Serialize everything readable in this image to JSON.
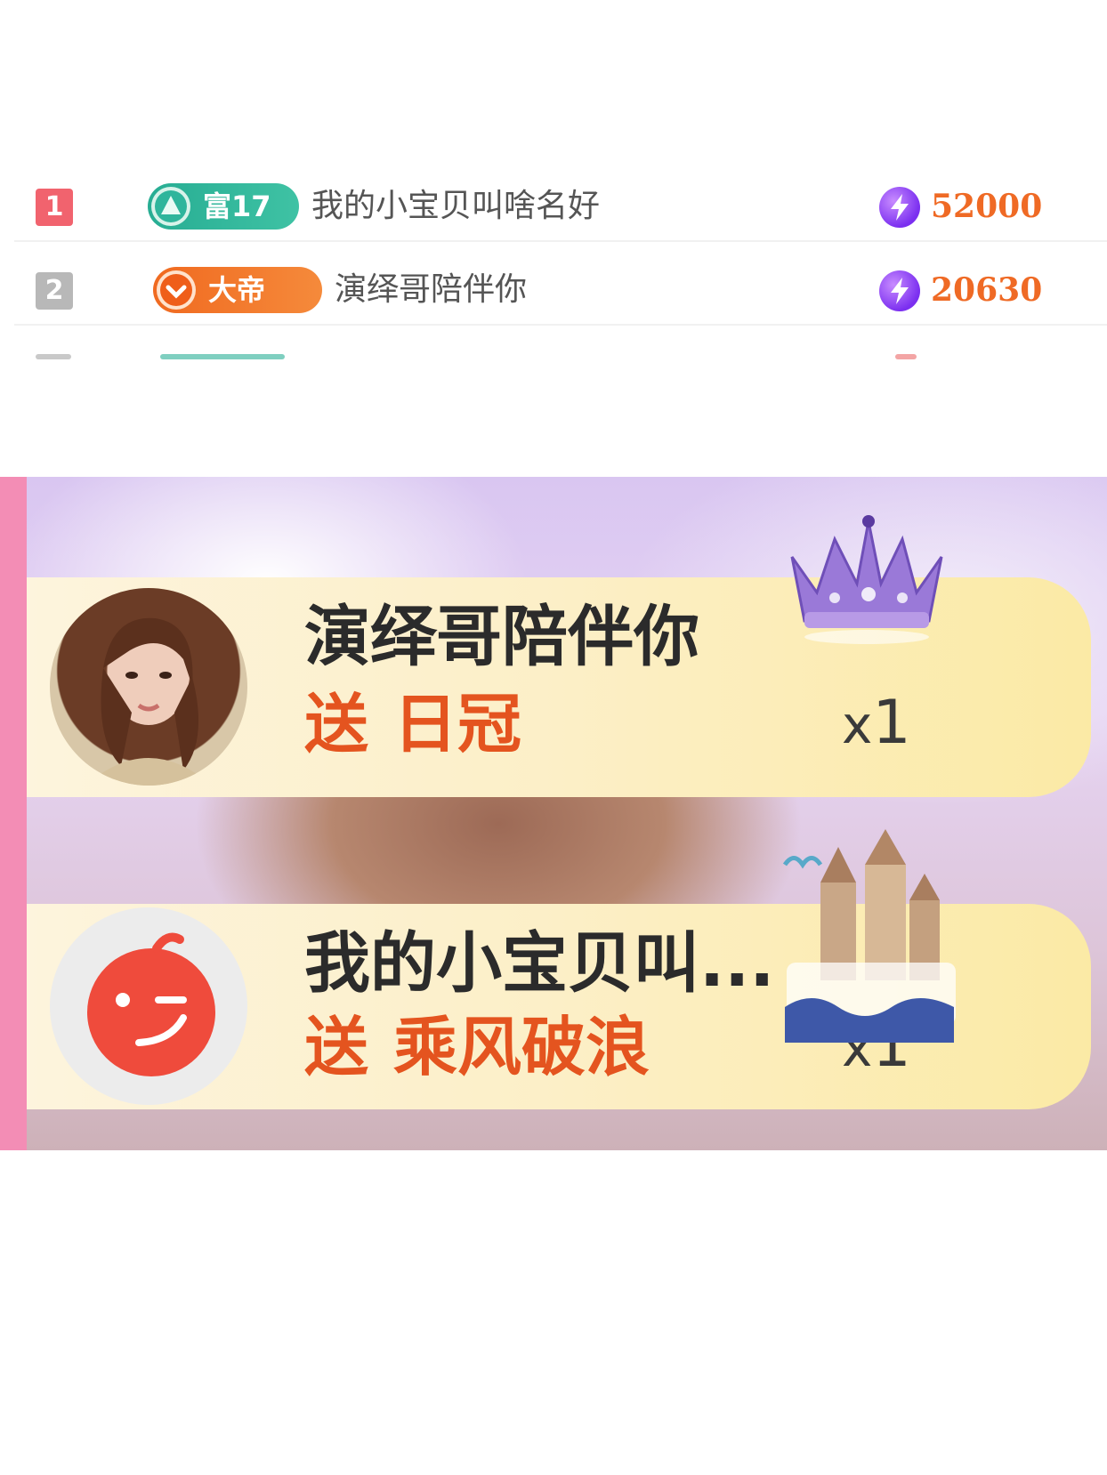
{
  "ranking": [
    {
      "rank": "1",
      "rank_color": "#f1636e",
      "badge_icon": "triangle-level-icon",
      "badge_text": "富17",
      "badge_color": "#2fb59c",
      "name": "我的小宝贝叫啥名好",
      "coin_icon": "lightning-coin-icon",
      "score": "52000"
    },
    {
      "rank": "2",
      "rank_color": "#b8b8b8",
      "badge_icon": "chevron-down-icon",
      "badge_text": "大帝",
      "badge_color": "#f07728",
      "name": "演绎哥陪伴你",
      "coin_icon": "lightning-coin-icon",
      "score": "20630"
    }
  ],
  "gifts": [
    {
      "avatar": "user-photo-avatar",
      "user": "演绎哥陪伴你",
      "action": "送",
      "gift_name": "日冠",
      "gift_icon": "crown-icon",
      "count_prefix": "x",
      "count": "1"
    },
    {
      "avatar": "winking-face-avatar",
      "user": "我的小宝贝叫...",
      "action": "送",
      "gift_name": "乘风破浪",
      "gift_icon": "castle-ship-icon",
      "count_prefix": "x",
      "count": "1"
    }
  ]
}
